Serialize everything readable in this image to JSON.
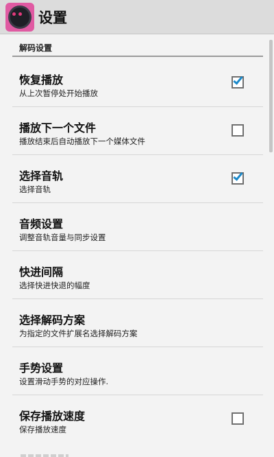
{
  "app": {
    "title": "设置",
    "icon": "app-logo-icon"
  },
  "section": {
    "title": "解码设置"
  },
  "prefs": [
    {
      "title": "恢复播放",
      "summary": "从上次暂停处开始播放",
      "checkbox": true,
      "checked": true
    },
    {
      "title": "播放下一个文件",
      "summary": "播放结束后自动播放下一个媒体文件",
      "checkbox": true,
      "checked": false
    },
    {
      "title": "选择音轨",
      "summary": "选择音轨",
      "checkbox": true,
      "checked": true
    },
    {
      "title": "音频设置",
      "summary": "调整音轨音量与同步设置",
      "checkbox": false
    },
    {
      "title": "快进间隔",
      "summary": "选择快进快退的幅度",
      "checkbox": false
    },
    {
      "title": "选择解码方案",
      "summary": "为指定的文件扩展名选择解码方案",
      "checkbox": false
    },
    {
      "title": "手势设置",
      "summary": "设置滑动手势的对应操作.",
      "checkbox": false
    },
    {
      "title": "保存播放速度",
      "summary": "保存播放速度",
      "checkbox": true,
      "checked": false
    }
  ],
  "colors": {
    "accent": "#1a88c9",
    "actionbar": "#dcdcdc",
    "background": "#f3f3f3"
  }
}
